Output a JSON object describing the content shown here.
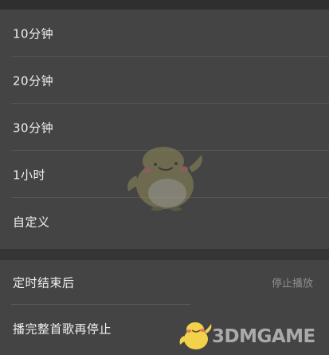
{
  "timer_options": [
    {
      "label": "10分钟"
    },
    {
      "label": "20分钟"
    },
    {
      "label": "30分钟"
    },
    {
      "label": "1小时"
    },
    {
      "label": "自定义"
    }
  ],
  "settings": {
    "after_timer_label": "定时结束后",
    "after_timer_value": "停止播放",
    "finish_song_label": "播完整首歌再停止"
  },
  "watermark": {
    "text": "3DMGAME"
  },
  "colors": {
    "background": "#3b3b3b",
    "panel": "#444444",
    "text": "#f0f0f0",
    "muted_text": "#8e8e8e"
  }
}
